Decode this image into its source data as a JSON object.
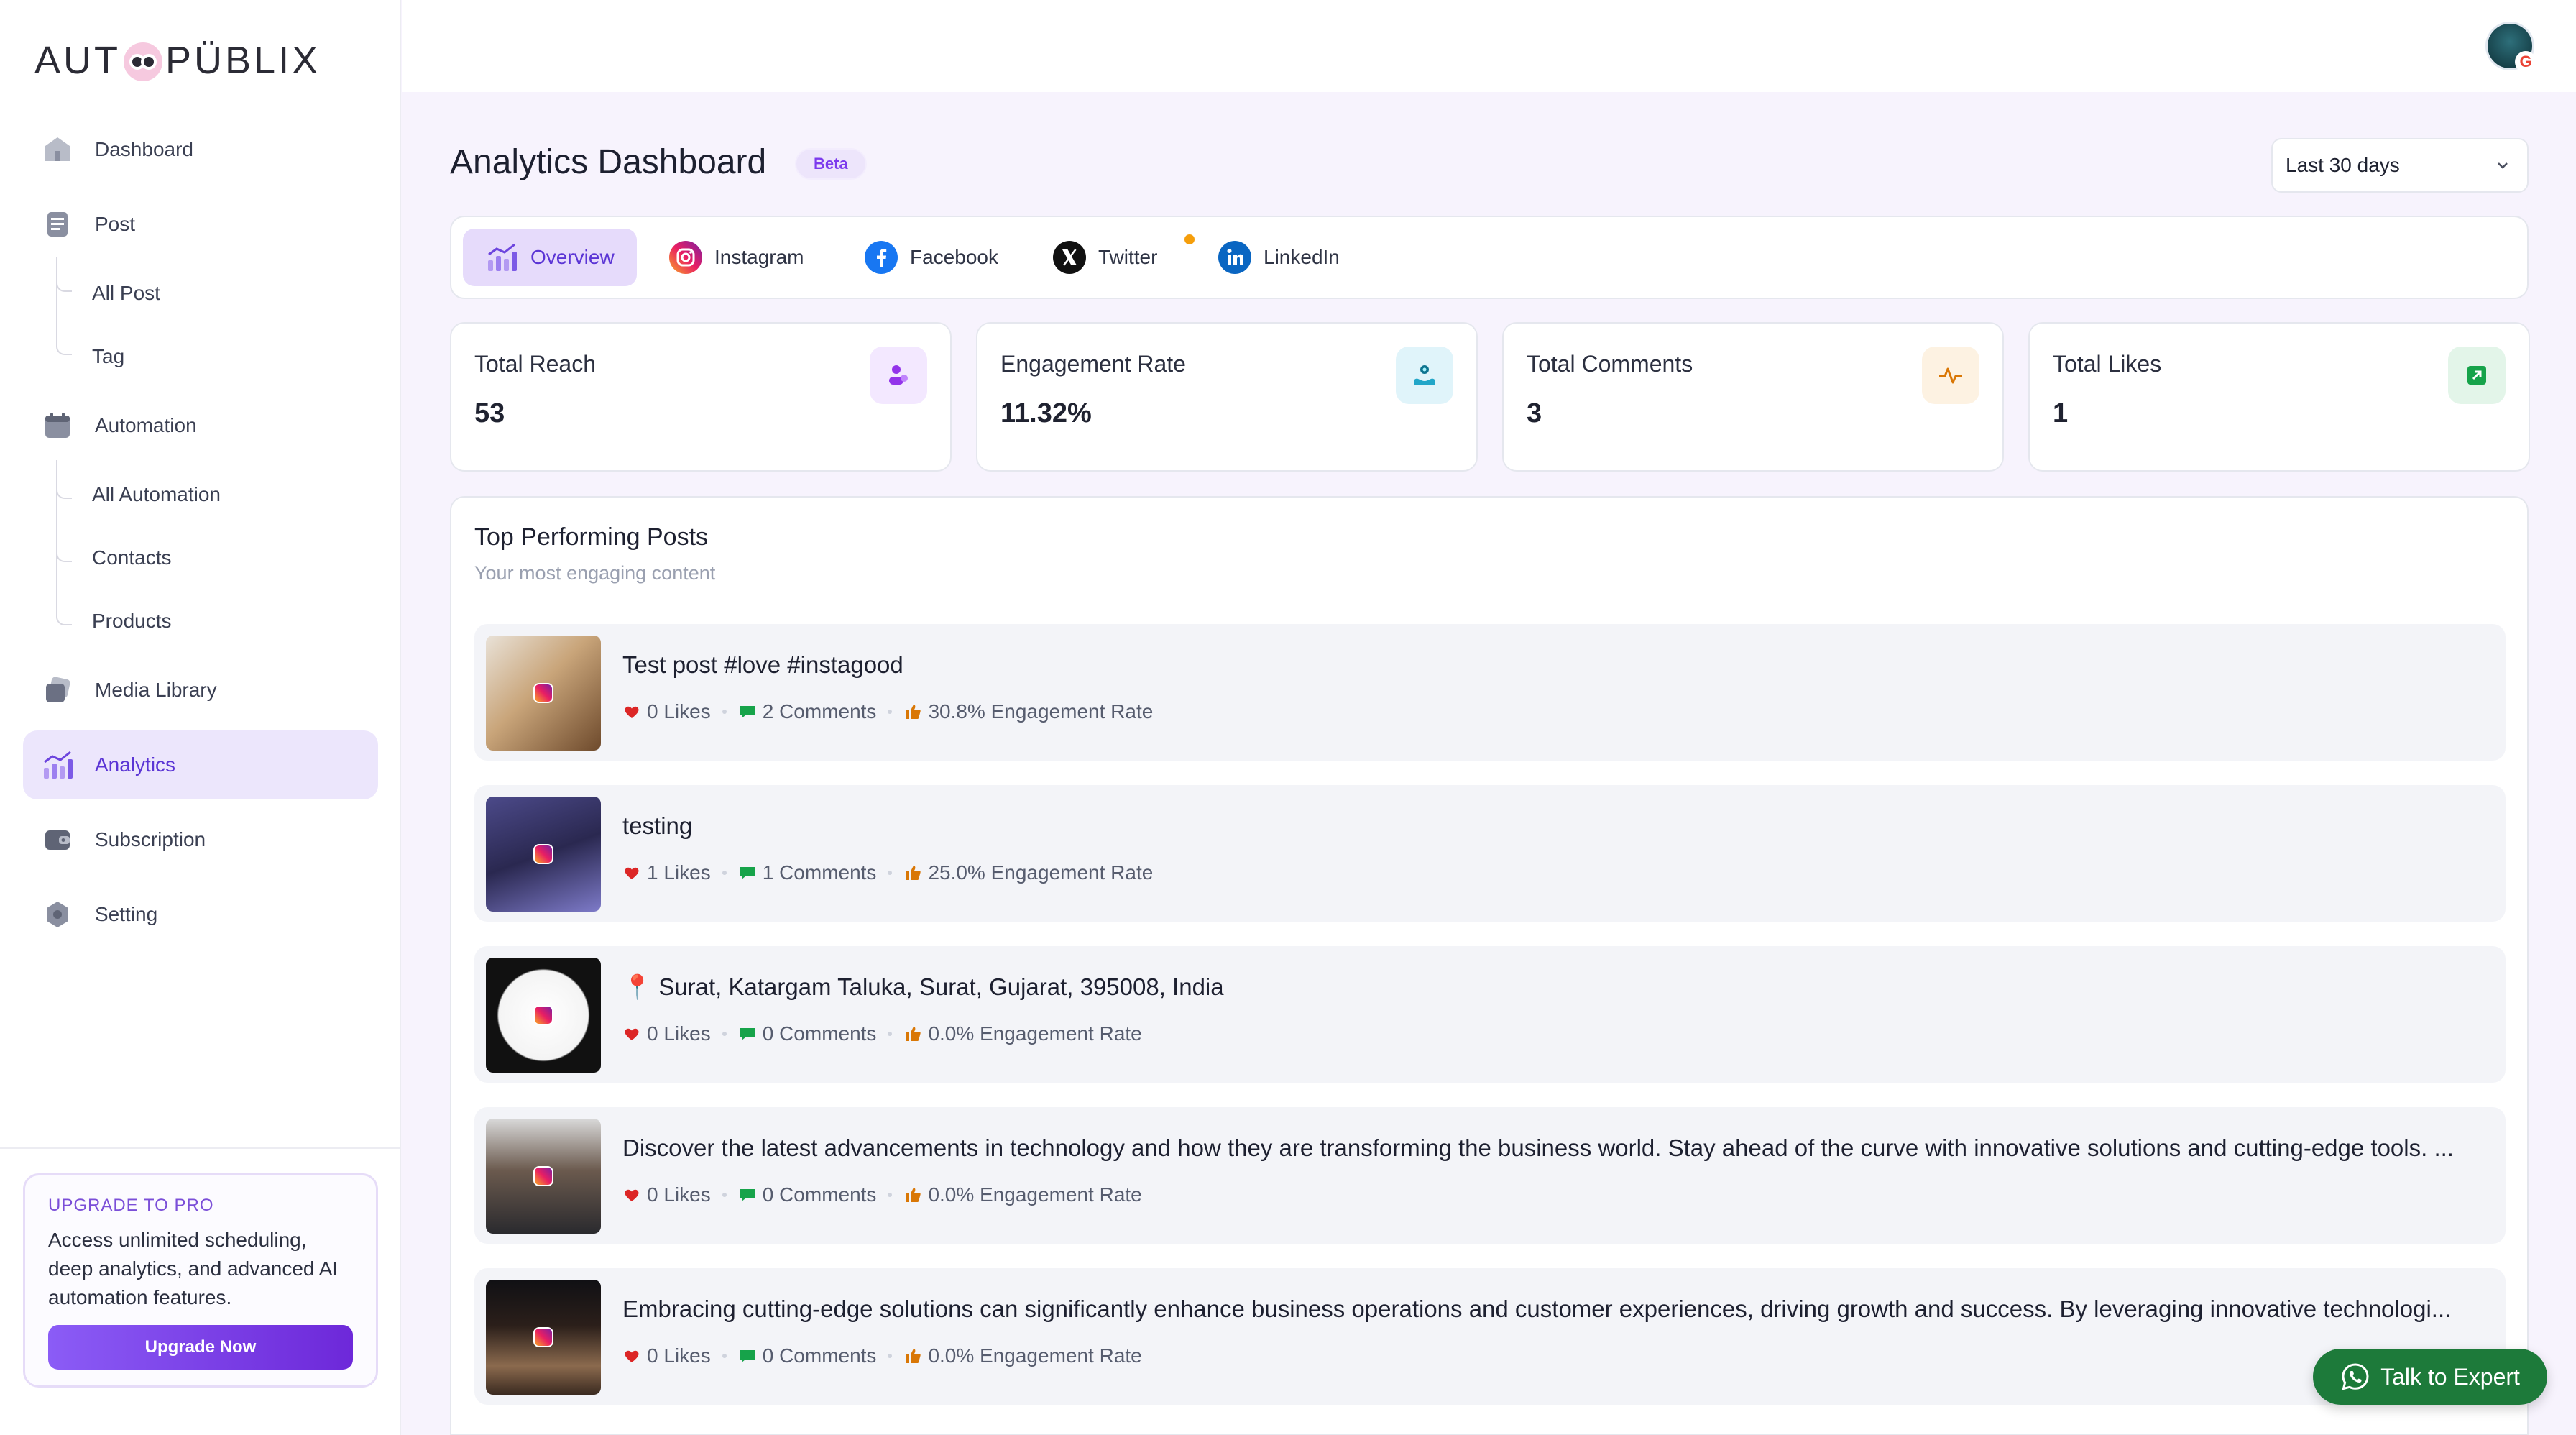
{
  "app": {
    "logo_left": "AUT",
    "logo_right": "PÜBLIX"
  },
  "sidebar": {
    "items": [
      {
        "label": "Dashboard",
        "icon": "home-icon"
      },
      {
        "label": "Post",
        "icon": "document-icon",
        "children": [
          "All Post",
          "Tag"
        ]
      },
      {
        "label": "Automation",
        "icon": "calendar-icon",
        "children": [
          "All Automation",
          "Contacts",
          "Products"
        ]
      },
      {
        "label": "Media Library",
        "icon": "media-icon"
      },
      {
        "label": "Analytics",
        "icon": "chart-icon",
        "active": true
      },
      {
        "label": "Subscription",
        "icon": "wallet-icon"
      },
      {
        "label": "Setting",
        "icon": "gear-icon"
      }
    ],
    "upgrade": {
      "title": "UPGRADE TO PRO",
      "description": "Access unlimited scheduling, deep analytics, and advanced AI automation features.",
      "button": "Upgrade Now"
    }
  },
  "header": {
    "title": "Analytics Dashboard",
    "badge": "Beta",
    "range": "Last 30 days"
  },
  "tabs": [
    {
      "label": "Overview",
      "active": true
    },
    {
      "label": "Instagram"
    },
    {
      "label": "Facebook"
    },
    {
      "label": "Twitter",
      "has_dot": true
    },
    {
      "label": "LinkedIn"
    }
  ],
  "stats": [
    {
      "label": "Total Reach",
      "value": "53",
      "icon": "users-icon",
      "color": "#9333ea"
    },
    {
      "label": "Engagement Rate",
      "value": "11.32%",
      "icon": "engagement-icon",
      "color": "#0ea5c6"
    },
    {
      "label": "Total Comments",
      "value": "3",
      "icon": "activity-icon",
      "color": "#d97706"
    },
    {
      "label": "Total Likes",
      "value": "1",
      "icon": "arrow-up-right-icon",
      "color": "#16a34a"
    }
  ],
  "top_posts": {
    "title": "Top Performing Posts",
    "subtitle": "Your most engaging content",
    "items": [
      {
        "text": "Test post #love #instagood",
        "likes": "0 Likes",
        "comments": "2 Comments",
        "rate": "30.8% Engagement Rate"
      },
      {
        "text": "testing",
        "likes": "1 Likes",
        "comments": "1 Comments",
        "rate": "25.0% Engagement Rate"
      },
      {
        "text": "📍 Surat, Katargam Taluka, Surat, Gujarat, 395008, India",
        "likes": "0 Likes",
        "comments": "0 Comments",
        "rate": "0.0% Engagement Rate"
      },
      {
        "text": "Discover the latest advancements in technology and how they are transforming the business world. Stay ahead of the curve with innovative solutions and cutting-edge tools. ...",
        "likes": "0 Likes",
        "comments": "0 Comments",
        "rate": "0.0% Engagement Rate"
      },
      {
        "text": "Embracing cutting-edge solutions can significantly enhance business operations and customer experiences, driving growth and success. By leveraging innovative technologi...",
        "likes": "0 Likes",
        "comments": "0 Comments",
        "rate": "0.0% Engagement Rate"
      }
    ]
  },
  "chat_button": "Talk to Expert"
}
